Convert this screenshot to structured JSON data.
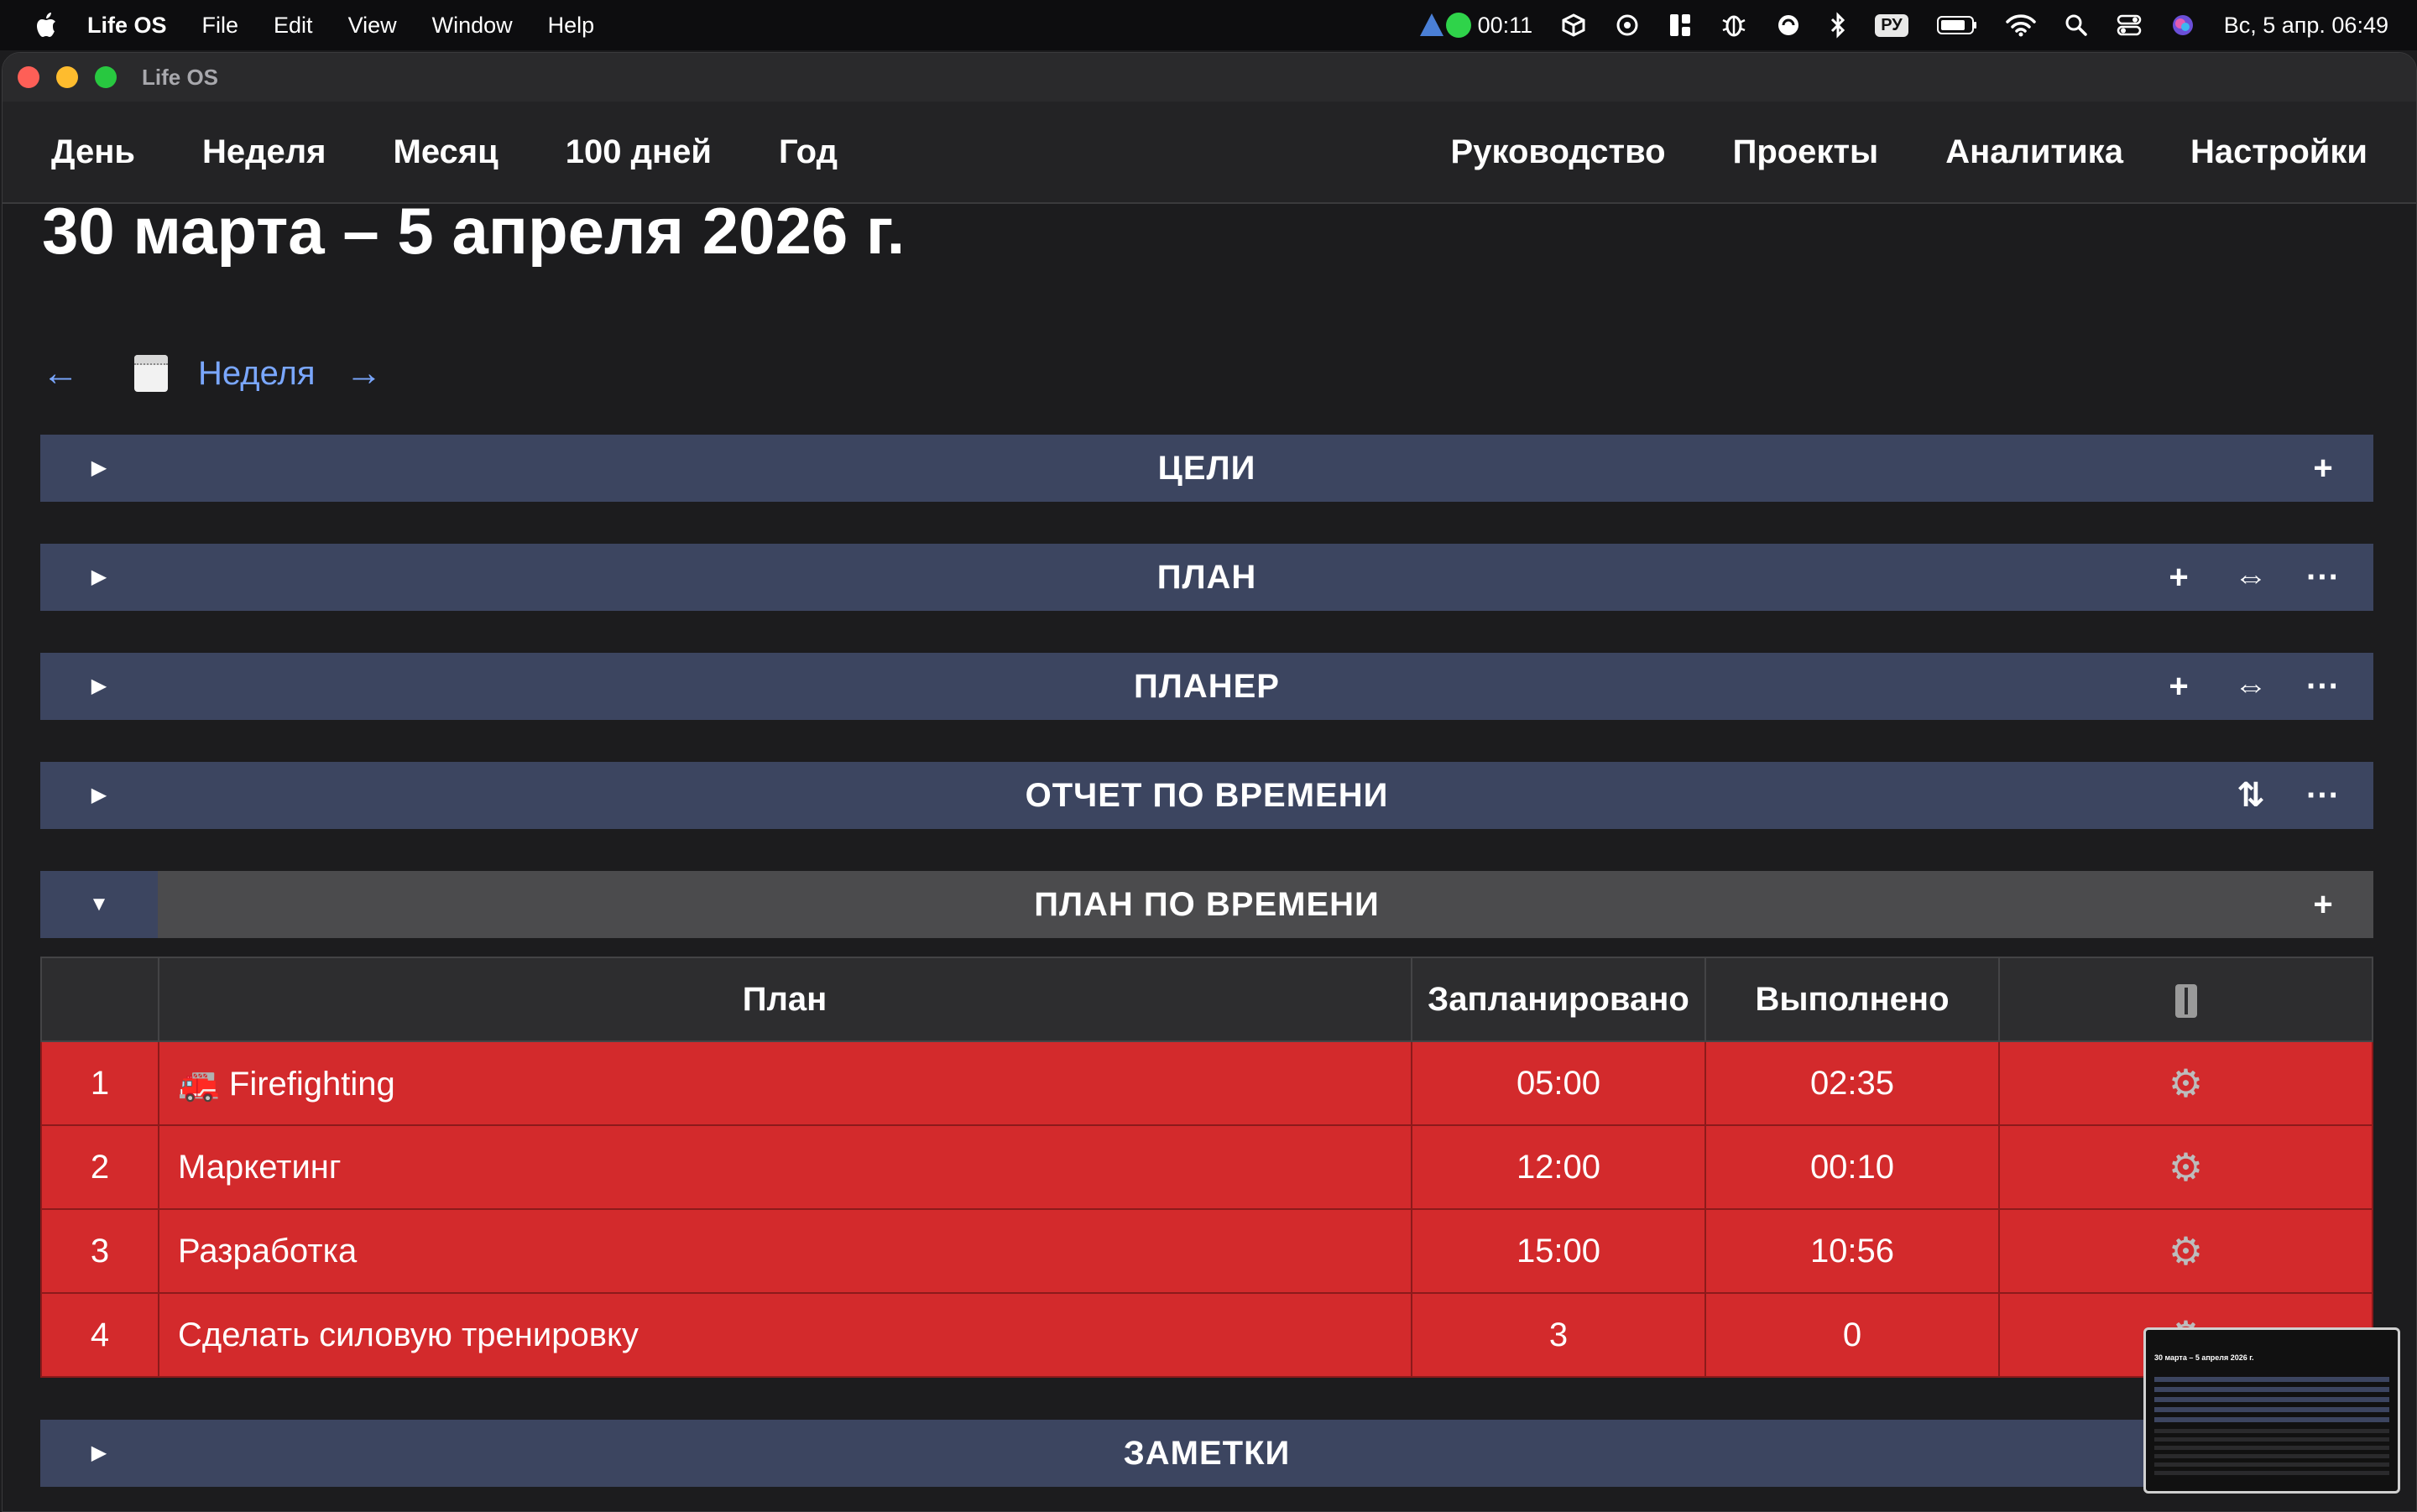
{
  "menubar": {
    "app": "Life OS",
    "menus": [
      "File",
      "Edit",
      "View",
      "Window",
      "Help"
    ],
    "timer": "00:11",
    "input_source": "РУ",
    "clock": "Вс, 5 апр.  06:49"
  },
  "window": {
    "title": "Life OS"
  },
  "nav": {
    "left": [
      "День",
      "Неделя",
      "Месяц",
      "100 дней",
      "Год"
    ],
    "right": [
      "Руководство",
      "Проекты",
      "Аналитика",
      "Настройки"
    ]
  },
  "page": {
    "title": "30 марта – 5 апреля 2026 г.",
    "prev_arrow": "←",
    "next_arrow": "→",
    "week_label": "Неделя"
  },
  "sections": {
    "goals": {
      "title": "ЦЕЛИ",
      "toggle": "▶"
    },
    "plan": {
      "title": "ПЛАН",
      "toggle": "▶"
    },
    "planner": {
      "title": "ПЛАНЕР",
      "toggle": "▶"
    },
    "time_report": {
      "title": "ОТЧЕТ ПО ВРЕМЕНИ",
      "toggle": "▶"
    },
    "time_plan": {
      "title": "ПЛАН ПО ВРЕМЕНИ",
      "toggle": "▼"
    },
    "notes": {
      "title": "ЗАМЕТКИ",
      "toggle": "▶"
    }
  },
  "actions": {
    "add": "+",
    "expand": "⇔",
    "more": "···",
    "sort": "⇅"
  },
  "table": {
    "headers": {
      "plan": "План",
      "planned": "Запланировано",
      "done": "Выполнено"
    },
    "rows": [
      {
        "num": "1",
        "name": "🚒 Firefighting",
        "planned": "05:00",
        "done": "02:35"
      },
      {
        "num": "2",
        "name": "Маркетинг",
        "planned": "12:00",
        "done": "00:10"
      },
      {
        "num": "3",
        "name": "Разработка",
        "planned": "15:00",
        "done": "10:56"
      },
      {
        "num": "4",
        "name": "Сделать силовую тренировку",
        "planned": "3",
        "done": "0"
      }
    ],
    "gear": "⚙"
  },
  "thumbnail": {
    "title": "30 марта – 5 апреля 2026 г."
  },
  "colors": {
    "section_bar": "#3c4560",
    "row_red": "#d32a2c",
    "link_blue": "#7aa7ff"
  }
}
